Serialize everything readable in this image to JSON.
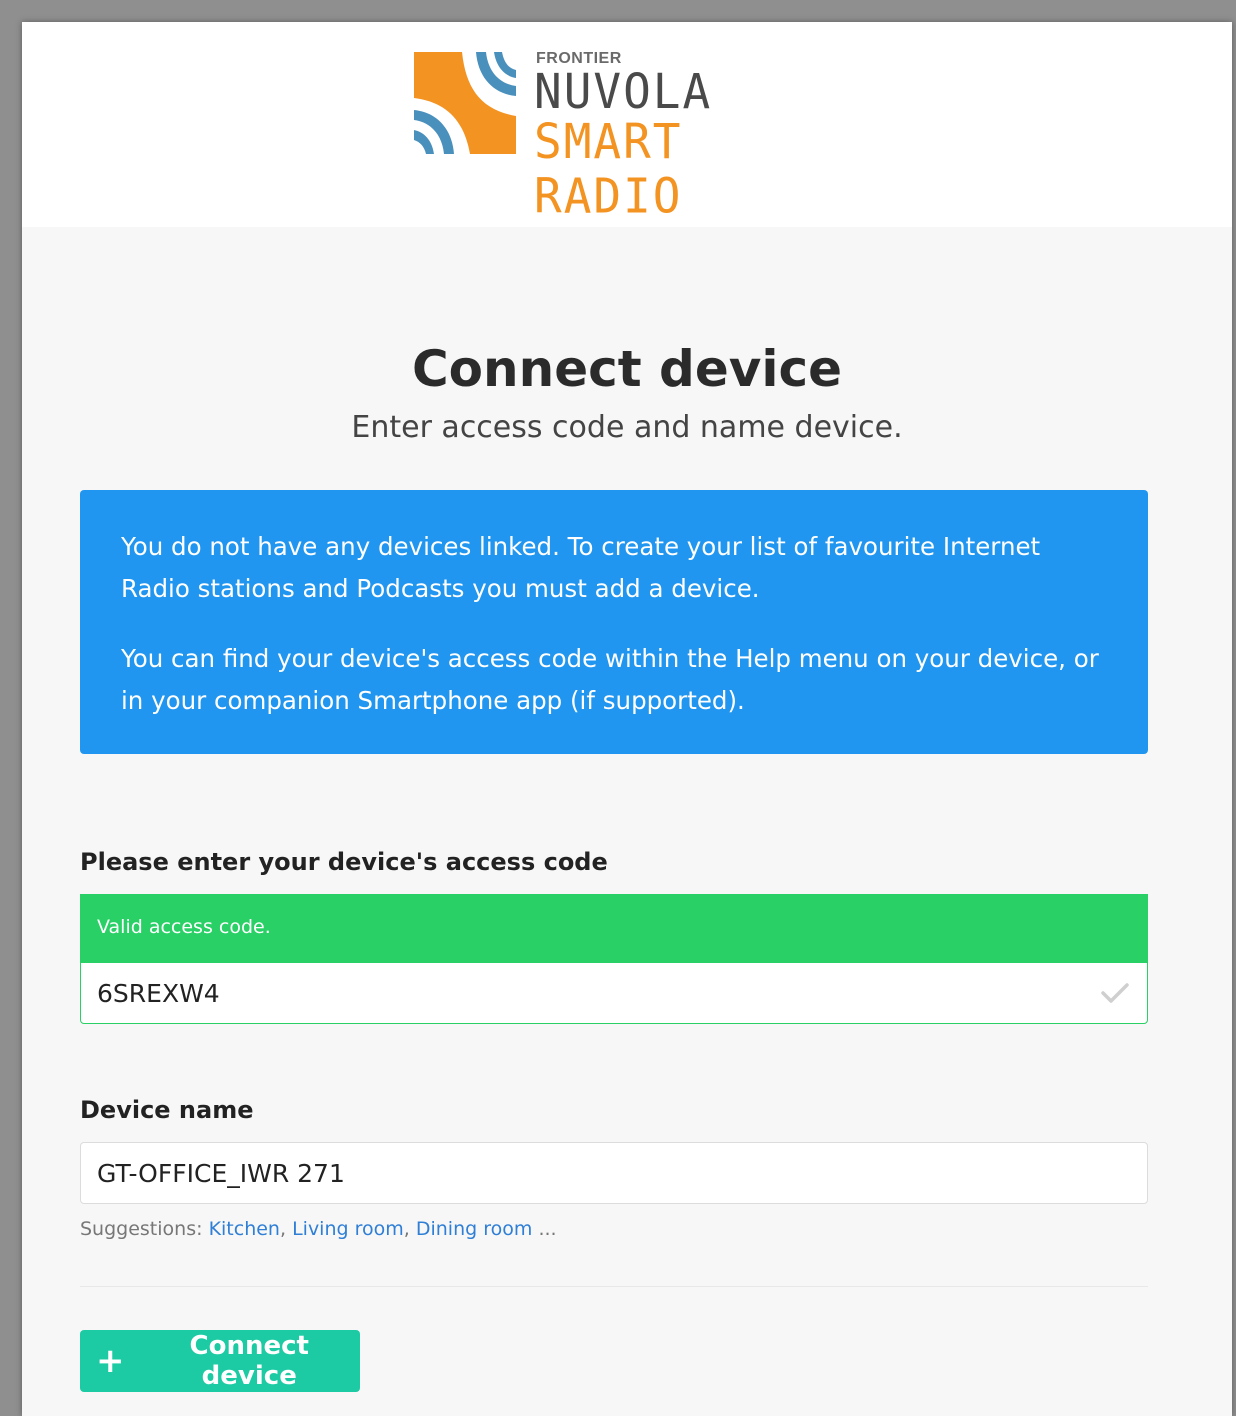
{
  "logo": {
    "brand": "FRONTIER",
    "title": "NUVOLA",
    "subtitle": "SMART RADIO",
    "colors": {
      "orange": "#f39322",
      "blue": "#4a90bd",
      "gray": "#4a4a4a"
    }
  },
  "page": {
    "title": "Connect device",
    "subtitle": "Enter access code and name device."
  },
  "info": {
    "color": "#2196f0",
    "paragraph1": "You do not have any devices linked. To create your list of favourite Internet Radio stations and Podcasts you must add a device.",
    "paragraph2": "You can find your device's access code within the Help menu on your device, or in your companion Smartphone app (if supported)."
  },
  "access_code": {
    "label": "Please enter your device's access code",
    "status": "Valid access code.",
    "status_color": "#28d065",
    "value": "6SREXW4",
    "status_icon": "check-icon"
  },
  "device_name": {
    "label": "Device name",
    "value": "GT-OFFICE_IWR 271",
    "suggestions_label": "Suggestions:",
    "suggestions": [
      "Kitchen",
      "Living room",
      "Dining room"
    ],
    "suggestions_more": "..."
  },
  "actions": {
    "connect_label": "Connect device",
    "connect_icon": "plus-icon",
    "connect_color": "#1ccba4"
  }
}
